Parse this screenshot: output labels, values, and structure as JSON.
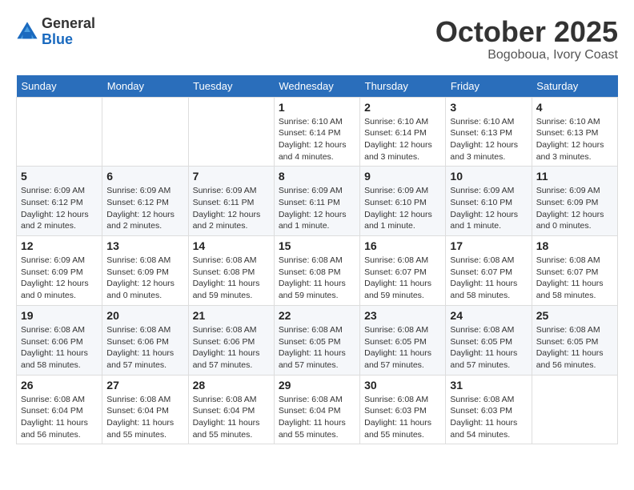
{
  "header": {
    "logo_general": "General",
    "logo_blue": "Blue",
    "month_title": "October 2025",
    "location": "Bogoboua, Ivory Coast"
  },
  "calendar": {
    "days_of_week": [
      "Sunday",
      "Monday",
      "Tuesday",
      "Wednesday",
      "Thursday",
      "Friday",
      "Saturday"
    ],
    "weeks": [
      [
        {
          "day": "",
          "info": ""
        },
        {
          "day": "",
          "info": ""
        },
        {
          "day": "",
          "info": ""
        },
        {
          "day": "1",
          "info": "Sunrise: 6:10 AM\nSunset: 6:14 PM\nDaylight: 12 hours\nand 4 minutes."
        },
        {
          "day": "2",
          "info": "Sunrise: 6:10 AM\nSunset: 6:14 PM\nDaylight: 12 hours\nand 3 minutes."
        },
        {
          "day": "3",
          "info": "Sunrise: 6:10 AM\nSunset: 6:13 PM\nDaylight: 12 hours\nand 3 minutes."
        },
        {
          "day": "4",
          "info": "Sunrise: 6:10 AM\nSunset: 6:13 PM\nDaylight: 12 hours\nand 3 minutes."
        }
      ],
      [
        {
          "day": "5",
          "info": "Sunrise: 6:09 AM\nSunset: 6:12 PM\nDaylight: 12 hours\nand 2 minutes."
        },
        {
          "day": "6",
          "info": "Sunrise: 6:09 AM\nSunset: 6:12 PM\nDaylight: 12 hours\nand 2 minutes."
        },
        {
          "day": "7",
          "info": "Sunrise: 6:09 AM\nSunset: 6:11 PM\nDaylight: 12 hours\nand 2 minutes."
        },
        {
          "day": "8",
          "info": "Sunrise: 6:09 AM\nSunset: 6:11 PM\nDaylight: 12 hours\nand 1 minute."
        },
        {
          "day": "9",
          "info": "Sunrise: 6:09 AM\nSunset: 6:10 PM\nDaylight: 12 hours\nand 1 minute."
        },
        {
          "day": "10",
          "info": "Sunrise: 6:09 AM\nSunset: 6:10 PM\nDaylight: 12 hours\nand 1 minute."
        },
        {
          "day": "11",
          "info": "Sunrise: 6:09 AM\nSunset: 6:09 PM\nDaylight: 12 hours\nand 0 minutes."
        }
      ],
      [
        {
          "day": "12",
          "info": "Sunrise: 6:09 AM\nSunset: 6:09 PM\nDaylight: 12 hours\nand 0 minutes."
        },
        {
          "day": "13",
          "info": "Sunrise: 6:08 AM\nSunset: 6:09 PM\nDaylight: 12 hours\nand 0 minutes."
        },
        {
          "day": "14",
          "info": "Sunrise: 6:08 AM\nSunset: 6:08 PM\nDaylight: 11 hours\nand 59 minutes."
        },
        {
          "day": "15",
          "info": "Sunrise: 6:08 AM\nSunset: 6:08 PM\nDaylight: 11 hours\nand 59 minutes."
        },
        {
          "day": "16",
          "info": "Sunrise: 6:08 AM\nSunset: 6:07 PM\nDaylight: 11 hours\nand 59 minutes."
        },
        {
          "day": "17",
          "info": "Sunrise: 6:08 AM\nSunset: 6:07 PM\nDaylight: 11 hours\nand 58 minutes."
        },
        {
          "day": "18",
          "info": "Sunrise: 6:08 AM\nSunset: 6:07 PM\nDaylight: 11 hours\nand 58 minutes."
        }
      ],
      [
        {
          "day": "19",
          "info": "Sunrise: 6:08 AM\nSunset: 6:06 PM\nDaylight: 11 hours\nand 58 minutes."
        },
        {
          "day": "20",
          "info": "Sunrise: 6:08 AM\nSunset: 6:06 PM\nDaylight: 11 hours\nand 57 minutes."
        },
        {
          "day": "21",
          "info": "Sunrise: 6:08 AM\nSunset: 6:06 PM\nDaylight: 11 hours\nand 57 minutes."
        },
        {
          "day": "22",
          "info": "Sunrise: 6:08 AM\nSunset: 6:05 PM\nDaylight: 11 hours\nand 57 minutes."
        },
        {
          "day": "23",
          "info": "Sunrise: 6:08 AM\nSunset: 6:05 PM\nDaylight: 11 hours\nand 57 minutes."
        },
        {
          "day": "24",
          "info": "Sunrise: 6:08 AM\nSunset: 6:05 PM\nDaylight: 11 hours\nand 57 minutes."
        },
        {
          "day": "25",
          "info": "Sunrise: 6:08 AM\nSunset: 6:05 PM\nDaylight: 11 hours\nand 56 minutes."
        }
      ],
      [
        {
          "day": "26",
          "info": "Sunrise: 6:08 AM\nSunset: 6:04 PM\nDaylight: 11 hours\nand 56 minutes."
        },
        {
          "day": "27",
          "info": "Sunrise: 6:08 AM\nSunset: 6:04 PM\nDaylight: 11 hours\nand 55 minutes."
        },
        {
          "day": "28",
          "info": "Sunrise: 6:08 AM\nSunset: 6:04 PM\nDaylight: 11 hours\nand 55 minutes."
        },
        {
          "day": "29",
          "info": "Sunrise: 6:08 AM\nSunset: 6:04 PM\nDaylight: 11 hours\nand 55 minutes."
        },
        {
          "day": "30",
          "info": "Sunrise: 6:08 AM\nSunset: 6:03 PM\nDaylight: 11 hours\nand 55 minutes."
        },
        {
          "day": "31",
          "info": "Sunrise: 6:08 AM\nSunset: 6:03 PM\nDaylight: 11 hours\nand 54 minutes."
        },
        {
          "day": "",
          "info": ""
        }
      ]
    ]
  }
}
